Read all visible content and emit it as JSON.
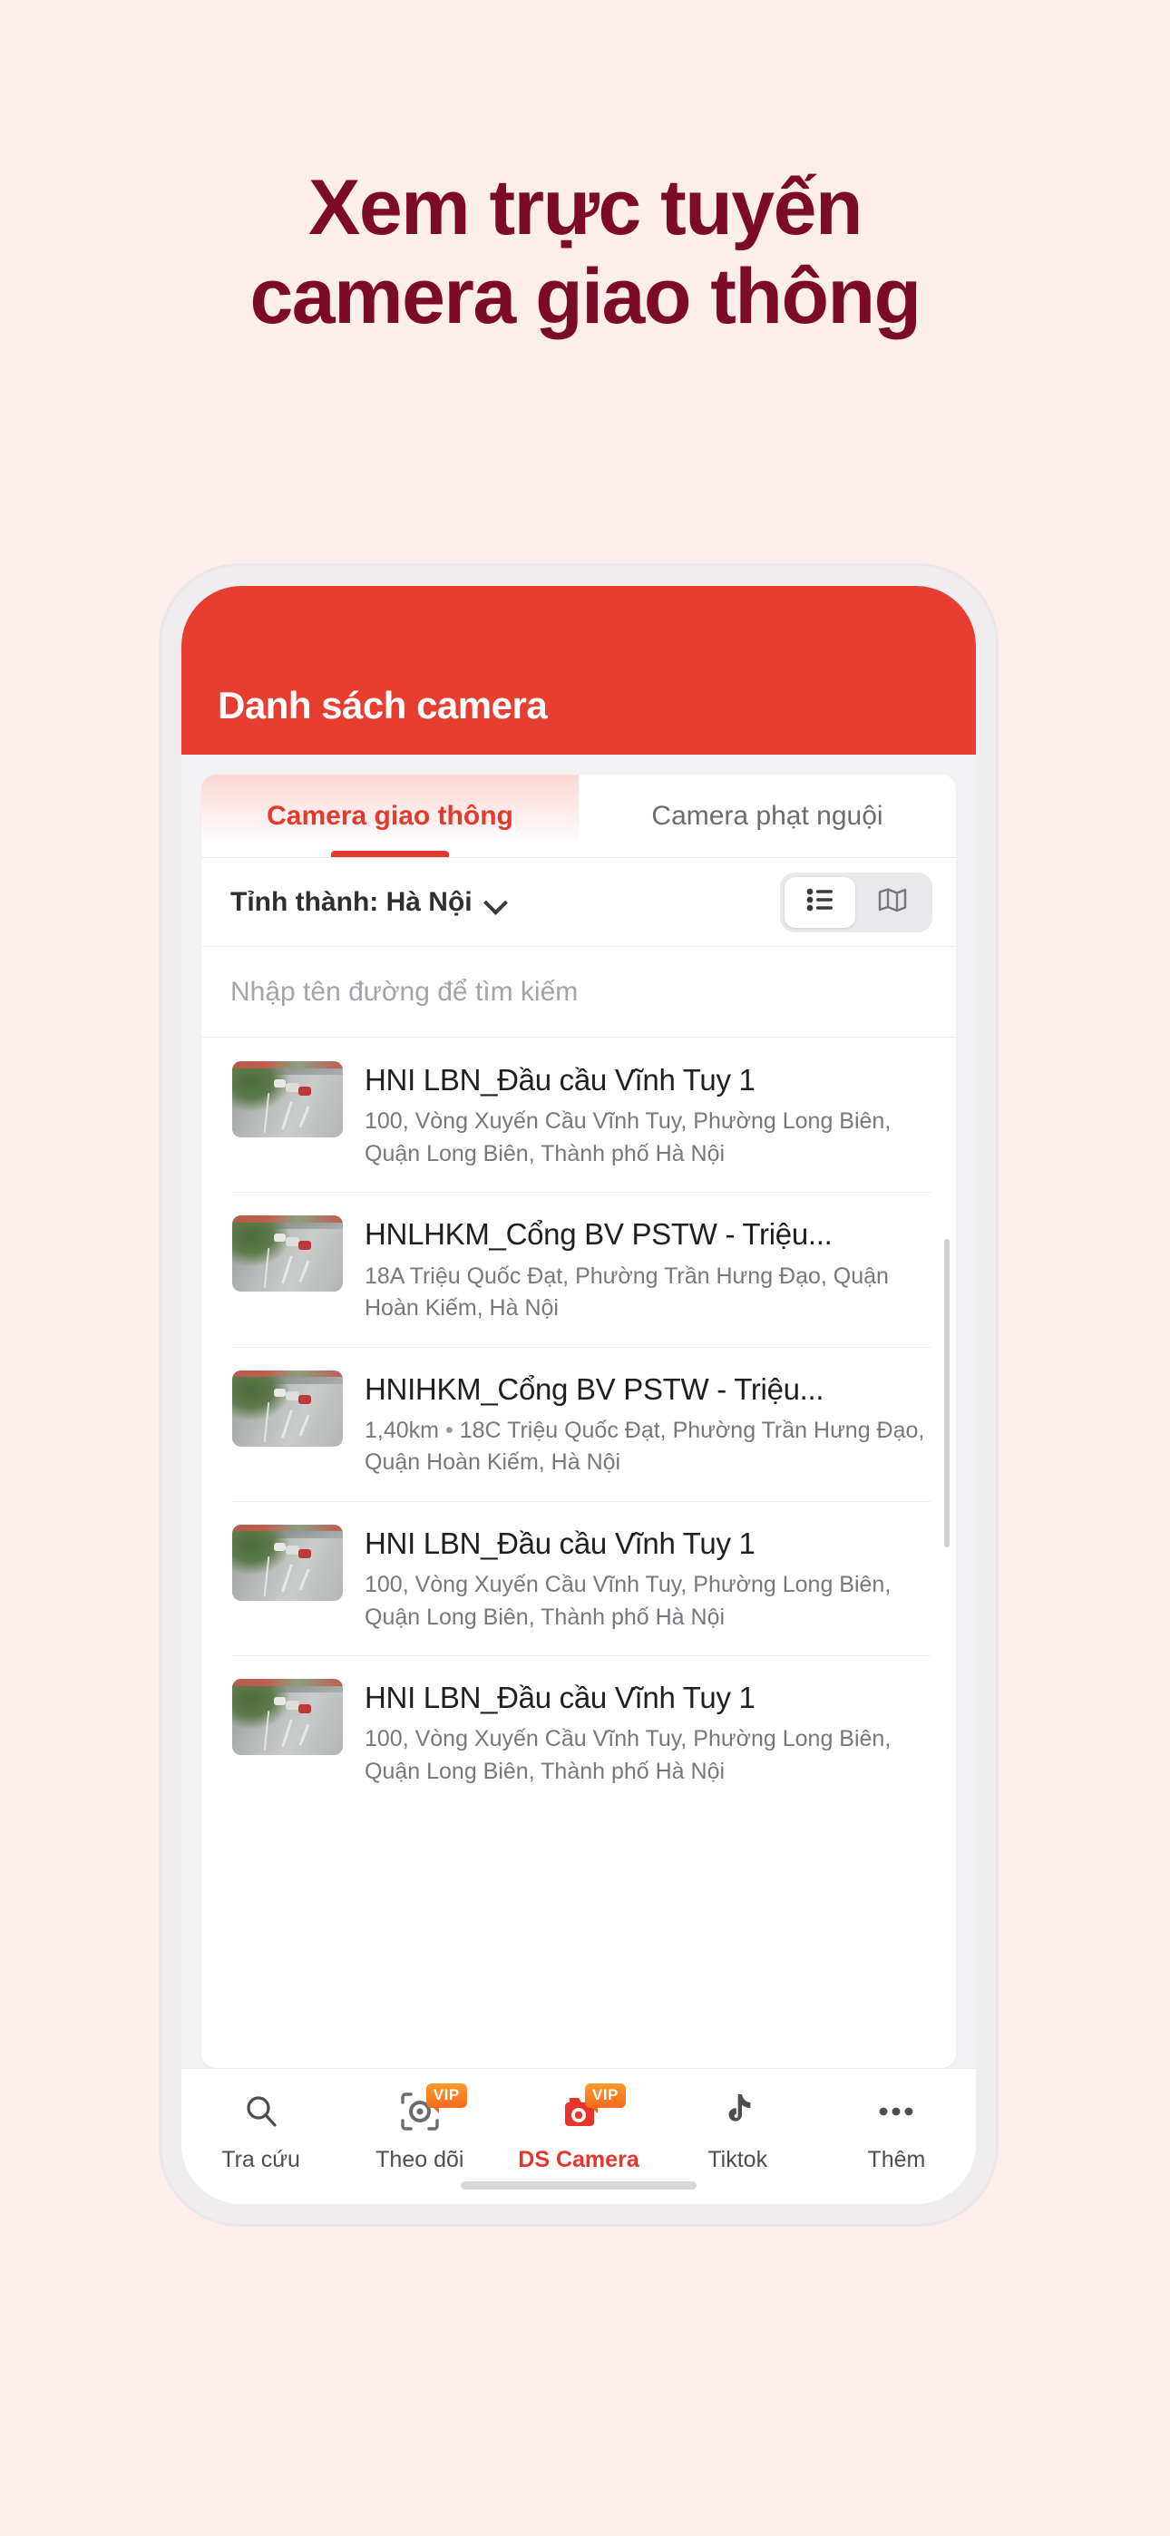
{
  "promo": {
    "line1": "Xem trực tuyến",
    "line2": "camera giao thông",
    "color": "#7C0B2B",
    "background": "#FDEEEB"
  },
  "app": {
    "header": {
      "title": "Danh sách camera",
      "background": "#E83E31",
      "text_color": "#FFFFFF"
    },
    "tabs": [
      {
        "label": "Camera giao thông",
        "active": true,
        "color": "#E23B2E"
      },
      {
        "label": "Camera phạt nguội",
        "active": false,
        "color": "#6C6C70"
      }
    ],
    "filter": {
      "label": "Tỉnh thành: Hà Nội",
      "chevron_icon": "chevron-down-icon",
      "view_toggle": [
        {
          "icon": "list-view-icon",
          "selected": true
        },
        {
          "icon": "map-view-icon",
          "selected": false
        }
      ]
    },
    "search": {
      "placeholder": "Nhập tên đường để tìm kiếm",
      "value": ""
    },
    "cameras": [
      {
        "name": "HNI LBN_Đầu cầu Vĩnh Tuy 1",
        "distance": "",
        "address": "100, Vòng Xuyến Cầu Vĩnh Tuy, Phường Long Biên, Quận Long Biên, Thành phố Hà Nội"
      },
      {
        "name": "HNLHKM_Cổng BV PSTW - Triệu...",
        "distance": "",
        "address": "18A Triệu Quốc Đạt, Phường Trần Hưng Đạo, Quận Hoàn Kiếm, Hà Nội"
      },
      {
        "name": "HNIHKM_Cổng BV PSTW - Triệu...",
        "distance": "1,40km",
        "address": "18C Triệu Quốc Đạt, Phường Trần Hưng Đạo, Quận Hoàn Kiếm, Hà Nội"
      },
      {
        "name": "HNI LBN_Đầu cầu Vĩnh Tuy 1",
        "distance": "",
        "address": "100, Vòng Xuyến Cầu Vĩnh Tuy, Phường Long Biên, Quận Long Biên, Thành phố Hà Nội"
      },
      {
        "name": "HNI LBN_Đầu cầu Vĩnh Tuy 1",
        "distance": "",
        "address": "100, Vòng Xuyến Cầu Vĩnh Tuy, Phường Long Biên, Quận Long Biên, Thành phố Hà Nội"
      }
    ],
    "bottom_nav": [
      {
        "label": "Tra cứu",
        "icon": "search-icon",
        "active": false,
        "badge": ""
      },
      {
        "label": "Theo dõi",
        "icon": "scan-camera-icon",
        "active": false,
        "badge": "VIP"
      },
      {
        "label": "DS Camera",
        "icon": "camera-icon",
        "active": true,
        "badge": "VIP"
      },
      {
        "label": "Tiktok",
        "icon": "tiktok-icon",
        "active": false,
        "badge": ""
      },
      {
        "label": "Thêm",
        "icon": "more-dots-icon",
        "active": false,
        "badge": ""
      }
    ]
  }
}
